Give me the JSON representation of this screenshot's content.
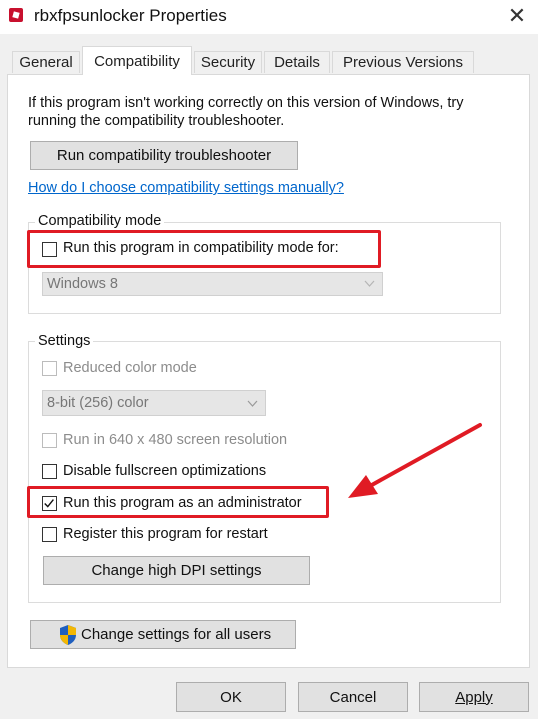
{
  "window": {
    "title": "rbxfpsunlocker Properties",
    "close_glyph": "✕"
  },
  "tabs": [
    {
      "label": "General"
    },
    {
      "label": "Compatibility",
      "active": true
    },
    {
      "label": "Security"
    },
    {
      "label": "Details"
    },
    {
      "label": "Previous Versions"
    }
  ],
  "intro": {
    "line1": "If this program isn't working correctly on this version of Windows, try",
    "line2": "running the compatibility troubleshooter."
  },
  "troubleshooter_button": "Run compatibility troubleshooter",
  "help_link": "How do I choose compatibility settings manually?",
  "compat_mode": {
    "label": "Compatibility mode",
    "checkbox_label": "Run this program in compatibility mode for:",
    "checked": false,
    "os_selected": "Windows 8"
  },
  "settings": {
    "label": "Settings",
    "reduced_color": {
      "label": "Reduced color mode",
      "checked": false,
      "enabled": false
    },
    "color_depth_selected": "8-bit (256) color",
    "res_640": {
      "label": "Run in 640 x 480 screen resolution",
      "checked": false,
      "enabled": false
    },
    "disable_fullscreen": {
      "label": "Disable fullscreen optimizations",
      "checked": false
    },
    "run_as_admin": {
      "label": "Run this program as an administrator",
      "checked": true
    },
    "register_restart": {
      "label": "Register this program for restart",
      "checked": false
    },
    "dpi_button": "Change high DPI settings"
  },
  "all_users_button": "Change settings for all users",
  "footer": {
    "ok": "OK",
    "cancel": "Cancel",
    "apply": "Apply"
  },
  "colors": {
    "highlight": "#e01b24",
    "link": "#0066cc",
    "shield_blue": "#1f5fbf",
    "shield_yellow": "#f2b705"
  },
  "icons": [
    "app-icon",
    "close-icon",
    "chevron-down-icon",
    "checkmark-icon",
    "shield-icon",
    "arrow-annotation"
  ]
}
